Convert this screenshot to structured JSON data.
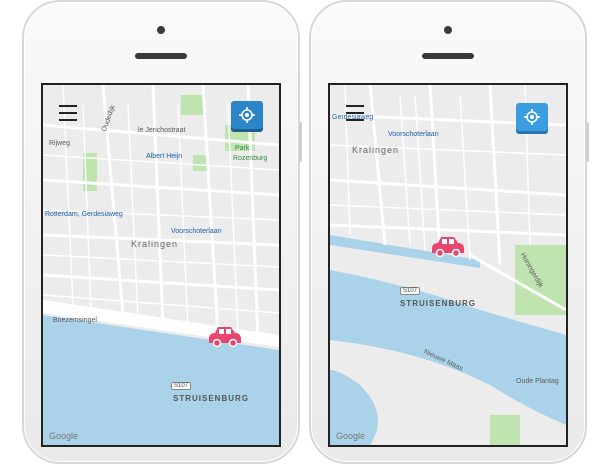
{
  "left_phone": {
    "labels": {
      "oudedijk": "Oudedijk",
      "rijweg": "Rijweg",
      "jerichostraat": "le Jerichostraat",
      "albert_heijn": "Albert Heijn",
      "park": "Park",
      "rozenburg": "Rozenburg",
      "rotterdam_station": "Rotterdam, Gerdesiaweg",
      "voorschoterlaan": "Voorschoterlaan",
      "kralingen": "Kralingen",
      "boezemsingel": "Boezemsingel",
      "struisenburg": "STRUISENBURG",
      "route": "S107",
      "google": "Google"
    }
  },
  "right_phone": {
    "labels": {
      "gerdesiaweg": "Gerdesiaweg",
      "voorschoterlaan": "Voorschoterlaan",
      "kralingen": "Kralingen",
      "struisenburg": "STRUISENBURG",
      "route": "S107",
      "nieuwe_maas": "Nieuwe Maas",
      "oude_plantage": "Oude Plantag",
      "honingerdijk": "Honingerdijk",
      "google": "Google"
    }
  },
  "colors": {
    "map_bg": "#ececec",
    "water": "#aad3ea",
    "park": "#bfe4b0",
    "car": "#e8466f",
    "locate_button": "#2b85c7"
  }
}
